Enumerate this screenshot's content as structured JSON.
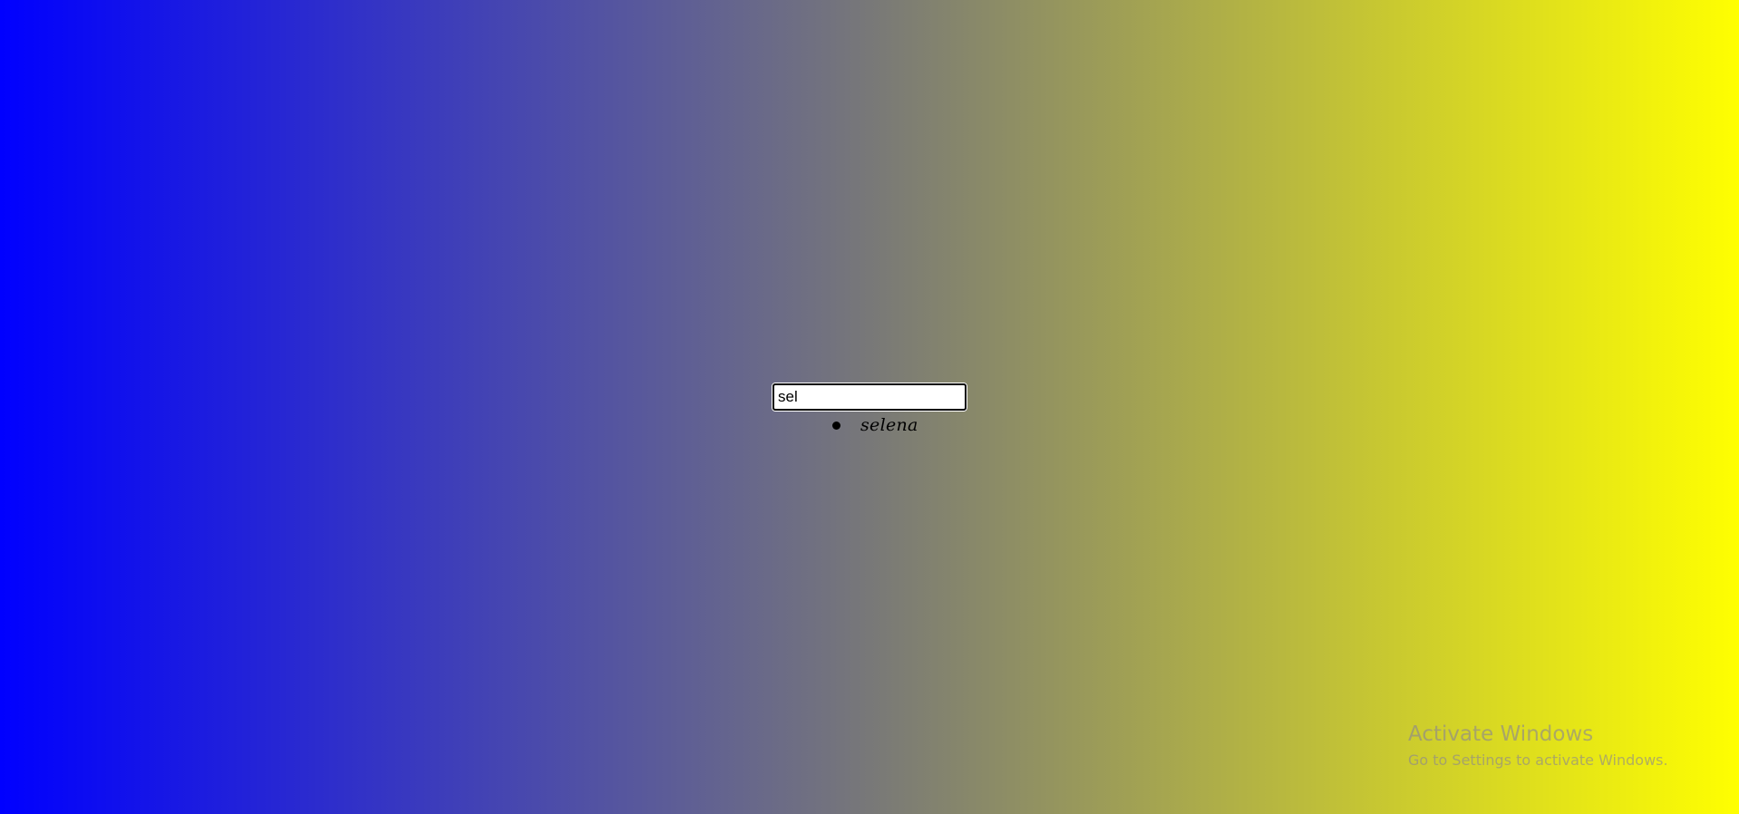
{
  "search": {
    "value": "sel",
    "suggestions": [
      "selena"
    ]
  },
  "watermark": {
    "title": "Activate Windows",
    "subtitle": "Go to Settings to activate Windows."
  },
  "colors": {
    "gradient_start": "#0000ff",
    "gradient_mid": "#787878",
    "gradient_end": "#ffff00"
  }
}
